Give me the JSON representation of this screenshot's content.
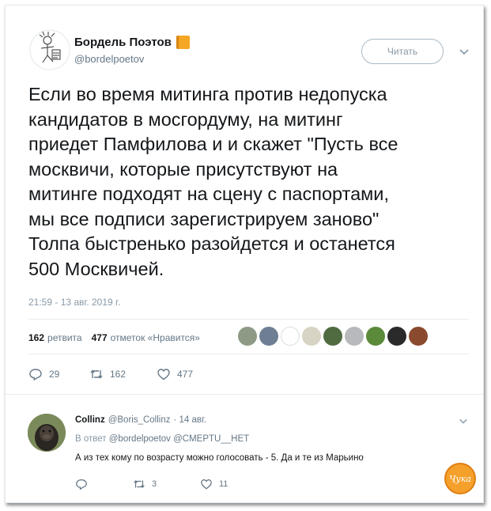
{
  "header": {
    "name": "Бордель Поэтов",
    "handle": "@bordelpoetov",
    "follow_label": "Читать"
  },
  "tweet": {
    "text": "Если во время митинга против недопуска\nкандидатов в мосгордуму, на митинг\nприедет Памфилова и и скажет \"Пусть все\nмосквичи, которые присутствуют на\nмитинге подходят на сцену с паспортами,\nмы все подписи зарегистрируем заново\"\nТолпа быстренько разойдется и останется\n500 Москвичей.",
    "timestamp": "21:59 - 13 авг. 2019 г."
  },
  "stats": {
    "retweets_count": "162",
    "retweets_label": "ретвита",
    "likes_count": "477",
    "likes_label": "отметок «Нравится»"
  },
  "actions": {
    "replies": "29",
    "retweets": "162",
    "likes": "477"
  },
  "reply": {
    "name": "Collinz",
    "handle": "@Boris_Collinz",
    "date": "· 14 авг.",
    "reply_to_prefix": "В ответ",
    "reply_to_mentions": "@bordelpoetov @CMEPTU__HET",
    "text": "А из тех кому по возрасту можно голосовать - 5. Да и те из Марьино",
    "retweets": "3",
    "likes": "11"
  },
  "watermark": {
    "text": "Ҷука"
  },
  "colors": {
    "text": "#14171a",
    "muted": "#657786",
    "border": "#e1e8ed",
    "book_icon": "#f5a623"
  }
}
